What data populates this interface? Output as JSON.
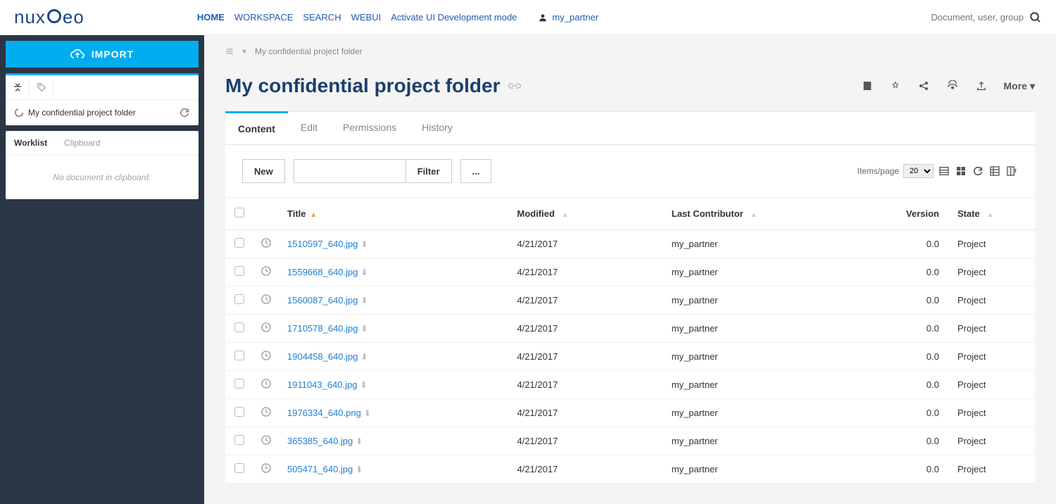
{
  "header": {
    "nav": {
      "home": "HOME",
      "workspace": "WORKSPACE",
      "search": "SEARCH",
      "webui": "WEBUI",
      "devmode": "Activate UI Development mode"
    },
    "user": "my_partner",
    "search_placeholder": "Document, user, group"
  },
  "sidebar": {
    "import": "IMPORT",
    "tree_item": "My confidential project folder",
    "worklist_tab": "Worklist",
    "clipboard_tab": "Clipboard",
    "clipboard_empty": "No document in clipboard."
  },
  "breadcrumb": {
    "title": "My confidential project folder"
  },
  "page_title": "My confidential project folder",
  "more_label": "More",
  "tabs": {
    "content": "Content",
    "edit": "Edit",
    "permissions": "Permissions",
    "history": "History"
  },
  "toolbar": {
    "new": "New",
    "filter": "Filter",
    "more": "...",
    "items_page": "Items/page",
    "page_size": "20"
  },
  "columns": {
    "title": "Title",
    "modified": "Modified",
    "contributor": "Last Contributor",
    "version": "Version",
    "state": "State"
  },
  "rows": [
    {
      "title": "1510597_640.jpg",
      "modified": "4/21/2017",
      "contributor": "my_partner",
      "version": "0.0",
      "state": "Project"
    },
    {
      "title": "1559668_640.jpg",
      "modified": "4/21/2017",
      "contributor": "my_partner",
      "version": "0.0",
      "state": "Project"
    },
    {
      "title": "1560087_640.jpg",
      "modified": "4/21/2017",
      "contributor": "my_partner",
      "version": "0.0",
      "state": "Project"
    },
    {
      "title": "1710578_640.jpg",
      "modified": "4/21/2017",
      "contributor": "my_partner",
      "version": "0.0",
      "state": "Project"
    },
    {
      "title": "1904458_640.jpg",
      "modified": "4/21/2017",
      "contributor": "my_partner",
      "version": "0.0",
      "state": "Project"
    },
    {
      "title": "1911043_640.jpg",
      "modified": "4/21/2017",
      "contributor": "my_partner",
      "version": "0.0",
      "state": "Project"
    },
    {
      "title": "1976334_640.png",
      "modified": "4/21/2017",
      "contributor": "my_partner",
      "version": "0.0",
      "state": "Project"
    },
    {
      "title": "365385_640.jpg",
      "modified": "4/21/2017",
      "contributor": "my_partner",
      "version": "0.0",
      "state": "Project"
    },
    {
      "title": "505471_640.jpg",
      "modified": "4/21/2017",
      "contributor": "my_partner",
      "version": "0.0",
      "state": "Project"
    }
  ]
}
